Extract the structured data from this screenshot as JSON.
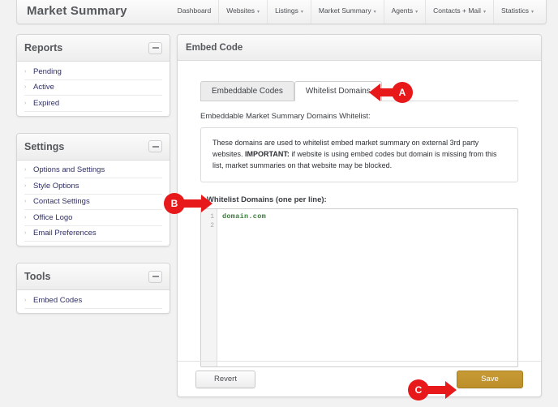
{
  "app": {
    "title": "Market Summary"
  },
  "topnav": {
    "items": [
      {
        "label": "Dashboard",
        "caret": false
      },
      {
        "label": "Websites",
        "caret": true
      },
      {
        "label": "Listings",
        "caret": true
      },
      {
        "label": "Market Summary",
        "caret": true
      },
      {
        "label": "Agents",
        "caret": true
      },
      {
        "label": "Contacts + Mail",
        "caret": true
      },
      {
        "label": "Statistics",
        "caret": true
      }
    ],
    "caret_glyph": "▾"
  },
  "sidebar": {
    "panels": [
      {
        "title": "Reports",
        "items": [
          {
            "label": "Pending"
          },
          {
            "label": "Active"
          },
          {
            "label": "Expired"
          }
        ]
      },
      {
        "title": "Settings",
        "items": [
          {
            "label": "Options and Settings"
          },
          {
            "label": "Style Options"
          },
          {
            "label": "Contact Settings"
          },
          {
            "label": "Office Logo"
          },
          {
            "label": "Email Preferences"
          }
        ]
      },
      {
        "title": "Tools",
        "items": [
          {
            "label": "Embed Codes"
          }
        ]
      }
    ],
    "item_arrow_glyph": "›"
  },
  "main": {
    "header_title": "Embed Code",
    "tabs": [
      {
        "label": "Embeddable Codes",
        "active": false
      },
      {
        "label": "Whitelist Domains",
        "active": true
      }
    ],
    "section_label": "Embeddable Market Summary Domains Whitelist:",
    "info_text_part1": "These domains are used to whitelist embed market summary on external 3rd party websites. ",
    "info_text_bold": "IMPORTANT:",
    "info_text_part2": " if website is using embed codes but domain is missing from this list, market summaries on that website may be blocked.",
    "editor_label": "1 Whitelist Domains (one per line):",
    "editor": {
      "line_numbers": [
        "1",
        "2"
      ],
      "lines": [
        "domain.com",
        ""
      ]
    },
    "footer": {
      "revert_label": "Revert",
      "save_label": "Save"
    }
  },
  "annotations": [
    {
      "id": "A",
      "letter": "A",
      "direction": "left"
    },
    {
      "id": "B",
      "letter": "B",
      "direction": "right"
    },
    {
      "id": "C",
      "letter": "C",
      "direction": "right"
    }
  ],
  "colors": {
    "annotation_red": "#e8191b",
    "save_gold": "#bc8f2a",
    "code_green": "#3a7d3a",
    "link_navy": "#2f2f66"
  }
}
